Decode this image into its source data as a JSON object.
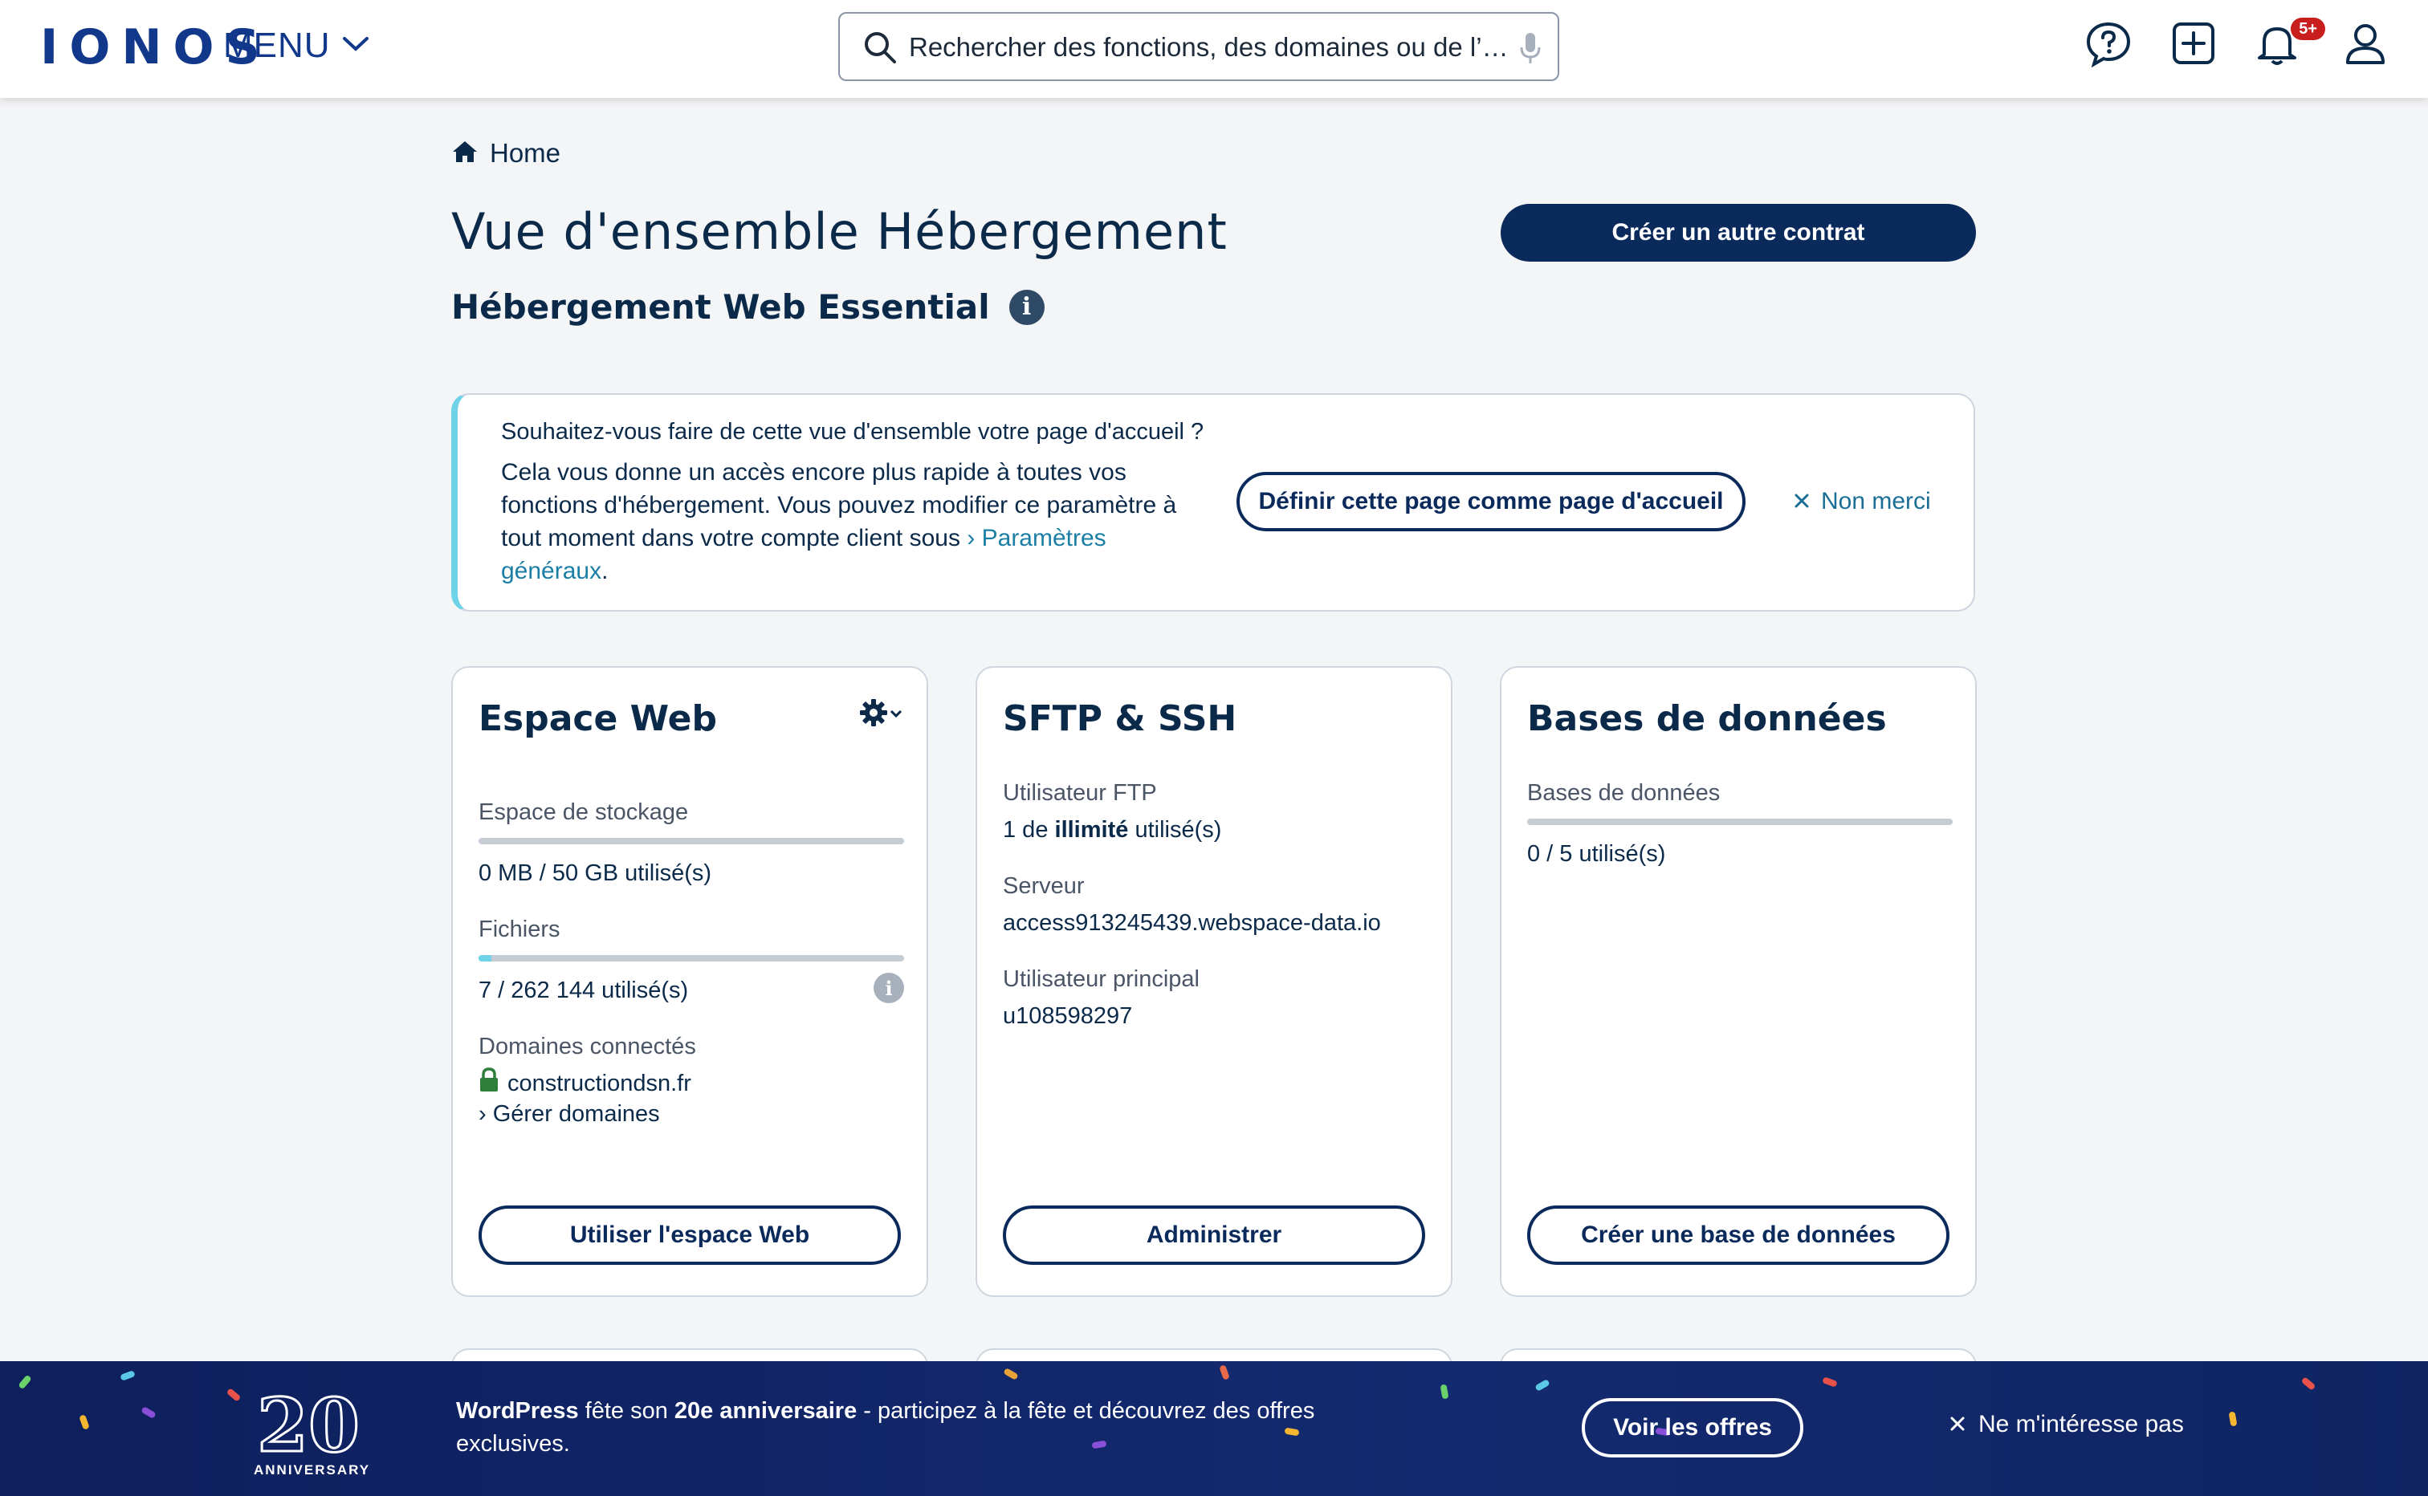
{
  "topbar": {
    "logo": "IONOS",
    "menu_label": "MENU",
    "search_placeholder": "Rechercher des fonctions, des domaines ou de l’…",
    "notification_badge": "5+"
  },
  "breadcrumb": {
    "home_label": "Home"
  },
  "page": {
    "title": "Vue d'ensemble Hébergement",
    "subtitle": "Hébergement Web Essential",
    "create_contract_label": "Créer un autre contrat"
  },
  "notice": {
    "title": "Souhaitez-vous faire de cette vue d'ensemble votre page d'accueil ?",
    "body": "Cela vous donne un accès encore plus rapide à toutes vos fonctions d'hébergement. Vous pouvez modifier ce paramètre à tout moment dans votre compte client sous",
    "link_label": "Paramètres généraux",
    "body_end": ".",
    "set_home_label": "Définir cette page comme page d'accueil",
    "dismiss_label": "Non merci"
  },
  "cards": {
    "webspace": {
      "title": "Espace Web",
      "storage_label": "Espace de stockage",
      "storage_fraction": 0,
      "storage_value": "0 MB / 50 GB utilisé(s)",
      "files_label": "Fichiers",
      "files_fraction": 0.03,
      "files_value": "7 / 262 144 utilisé(s)",
      "domains_label": "Domaines connectés",
      "domain": "constructiondsn.fr",
      "manage_domains_label": "Gérer domaines",
      "button_label": "Utiliser l'espace Web"
    },
    "sftp": {
      "title": "SFTP & SSH",
      "ftp_user_label": "Utilisateur FTP",
      "ftp_user_prefix": "1 de",
      "ftp_user_bold": "illimité",
      "ftp_user_suffix": "utilisé(s)",
      "server_label": "Serveur",
      "server_value": "access913245439.webspace-data.io",
      "main_user_label": "Utilisateur principal",
      "main_user_value": "u108598297",
      "button_label": "Administrer"
    },
    "databases": {
      "title": "Bases de données",
      "db_label": "Bases de données",
      "db_fraction": 0,
      "db_value": "0 / 5 utilisé(s)",
      "button_label": "Créer une base de données"
    }
  },
  "banner": {
    "anniversary_number": "20",
    "anniversary_label": "ANNIVERSARY",
    "text_bold_1": "WordPress",
    "text_1": " fête son ",
    "text_bold_2": "20e anniversaire",
    "text_2": " - participez à la fête et découvrez des offres exclusives.",
    "cta_label": "Voir les offres",
    "dismiss_label": "Ne m'intéresse pas"
  },
  "colors": {
    "brand_navy": "#0b2a5c",
    "accent_cyan": "#6ed2e8",
    "link": "#1b7fa5",
    "badge_red": "#c81e1e"
  }
}
